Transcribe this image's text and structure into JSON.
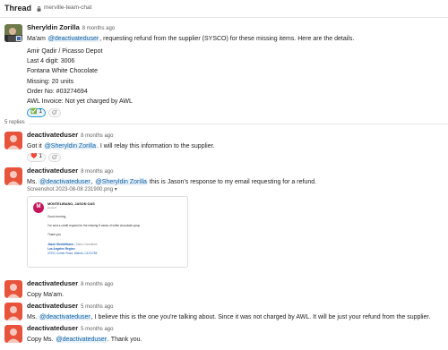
{
  "header": {
    "title": "Thread",
    "channel": "merville-team-chat"
  },
  "parent": {
    "author": "Sheryldin Zorilla",
    "time": "8 months ago",
    "text_before": "Ma'am ",
    "mention": "@deactivateduser",
    "text_after": ", requesting refund from the supplier (SYSCO) for these missing items. Here are the details.",
    "details": [
      "Amir Qadir / Picasso Depot",
      "Last 4 digit: 3006",
      "Fontana White Chocolate",
      "Missing: 20 units",
      "Order No: #03274694",
      "AWL Invoice: Not yet charged by AWL"
    ],
    "reaction": {
      "emoji": "✅",
      "count": "1"
    }
  },
  "replies_label": "5 replies",
  "replies": [
    {
      "author": "deactivateduser",
      "time": "8 months ago",
      "text_before": "Got it ",
      "mention": "@Sheryldin Zorilla",
      "text_after": ". I will relay this information to the supplier.",
      "reaction": {
        "emoji": "❤️",
        "count": "1"
      }
    },
    {
      "author": "deactivateduser",
      "time": "8 months ago",
      "text_before": "Ms. ",
      "mention": "@deactivateduser",
      "mid": ", ",
      "mention2": "@Sheryldin Zorilla",
      "text_after": " this is Jason's response to my email requesting for a refund.",
      "attachment_label": "Screenshot 2023-08-08 231900.png ▾",
      "email": {
        "avatar_letter": "M",
        "sender": "MONTELIBANO, JASON OAS",
        "to": "to me ▾",
        "greeting": "Good morning,",
        "body": "I've sent a credit request for the missing 5 cases of white chocolate syrup",
        "thanks": "Thank you",
        "sig_name": "Jason Montelibano",
        "sig_role": " | Sales Consultant",
        "sig_region": "Los Angeles Region",
        "sig_address": "20701 Currier Road, Walnut, CA 91789"
      }
    },
    {
      "author": "deactivateduser",
      "time": "8 months ago",
      "text": "Copy Ma'am."
    },
    {
      "author": "deactivateduser",
      "time": "5 months ago",
      "text_before": "Ms. ",
      "mention": "@deactivateduser",
      "text_after": ", I believe this is the one you're talking about. Since it was not charged by AWL. It will be just your refund from the supplier."
    },
    {
      "author": "deactivateduser",
      "time": "5 months ago",
      "text_before": "Copy Ms. ",
      "mention": "@deactivateduser",
      "text_after": ". Thank you."
    }
  ],
  "colors": {
    "mention_bg": "#e8f1fa",
    "mention_fg": "#1264a3",
    "avatar_user": "#e8533b"
  },
  "icons": {
    "add_reaction": "add-reaction-icon",
    "lock": "lock-icon"
  }
}
